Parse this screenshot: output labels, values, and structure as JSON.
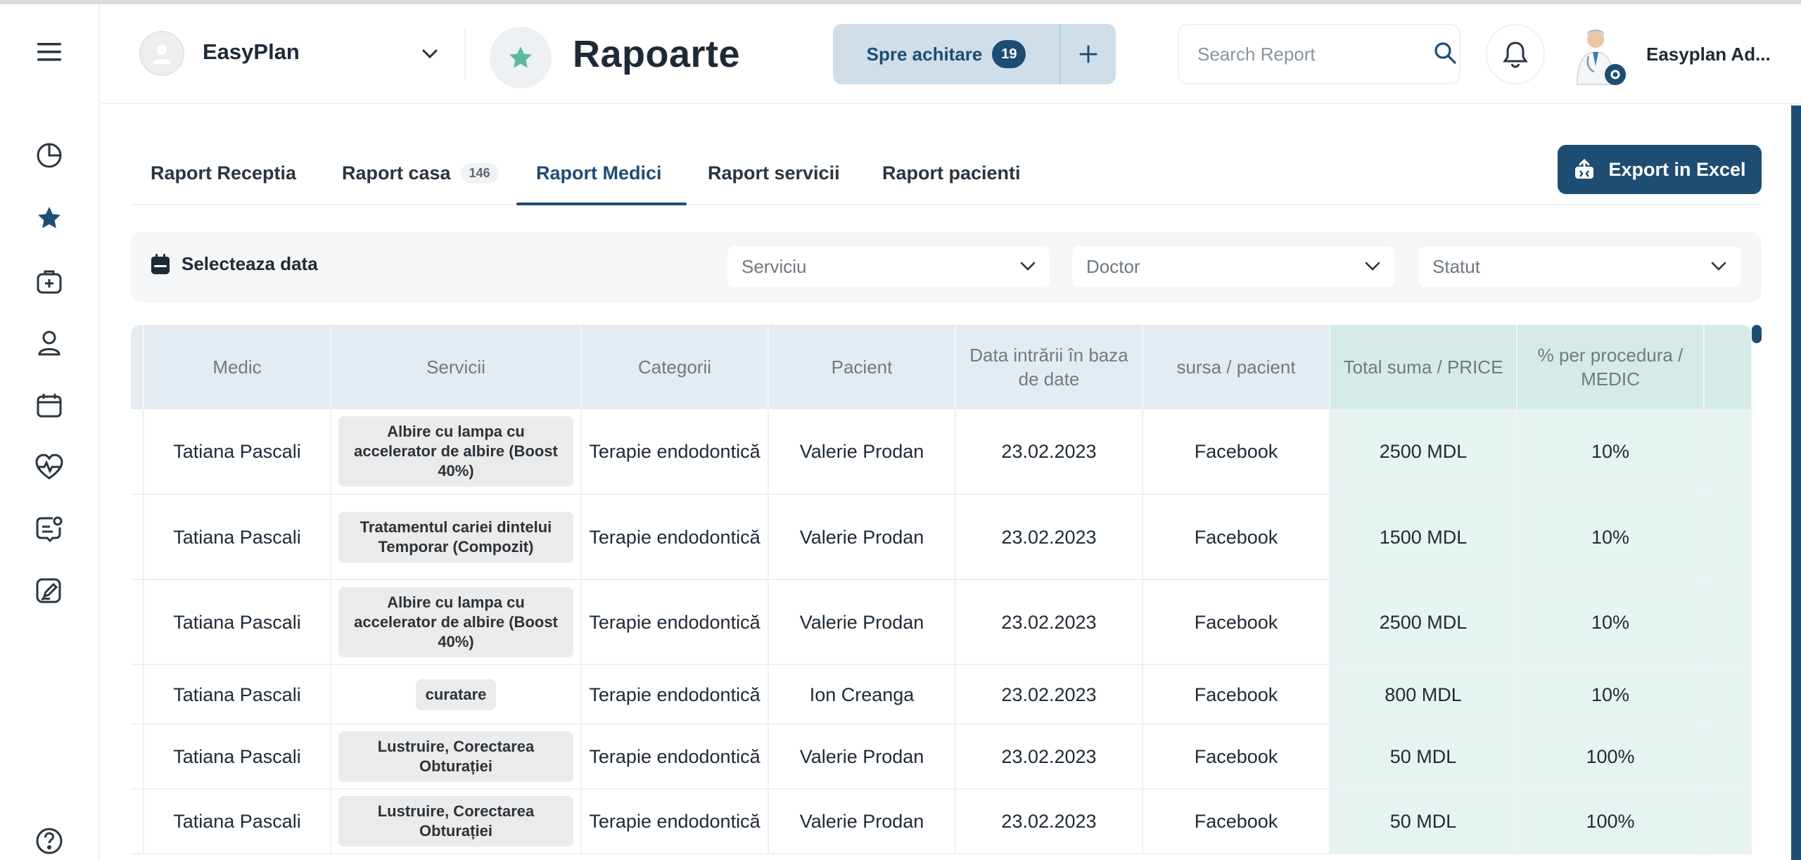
{
  "header": {
    "clinic_name": "EasyPlan",
    "page_title": "Rapoarte",
    "pay_label": "Spre achitare",
    "pay_count": "19",
    "search_placeholder": "Search Report",
    "user_name": "Easyplan Ad..."
  },
  "sidebar": {
    "icons": [
      "menu-icon",
      "pie-chart-icon",
      "star-icon",
      "medical-bag-icon",
      "user-icon",
      "calendar-icon",
      "heart-pulse-icon",
      "message-user-icon",
      "edit-document-icon",
      "help-icon"
    ]
  },
  "tabs": [
    {
      "label": "Raport Receptia",
      "badge": ""
    },
    {
      "label": "Raport casa",
      "badge": "146"
    },
    {
      "label": "Raport Medici",
      "badge": ""
    },
    {
      "label": "Raport servicii",
      "badge": ""
    },
    {
      "label": "Raport pacienti",
      "badge": ""
    }
  ],
  "active_tab": "Raport Medici",
  "export_label": "Export in Excel",
  "filters": {
    "date_label": "Selecteaza data",
    "service": "Serviciu",
    "doctor": "Doctor",
    "status": "Statut"
  },
  "table": {
    "columns": [
      "Medic",
      "Servicii",
      "Categorii",
      "Pacient",
      "Data intrării în baza de date",
      "sursa / pacient",
      "Total suma / PRICE",
      "% per procedura / MEDIC"
    ],
    "rows": [
      {
        "medic": "Tatiana Pascali",
        "service": "Albire cu lampa cu accelerator de albire (Boost 40%)",
        "category": "Terapie endodontică",
        "patient": "Valerie Prodan",
        "date": "23.02.2023",
        "source": "Facebook",
        "total": "2500 MDL",
        "percent": "10%"
      },
      {
        "medic": "Tatiana Pascali",
        "service": "Tratamentul cariei dintelui Temporar (Compozit)",
        "category": "Terapie endodontică",
        "patient": "Valerie Prodan",
        "date": "23.02.2023",
        "source": "Facebook",
        "total": "1500 MDL",
        "percent": "10%"
      },
      {
        "medic": "Tatiana Pascali",
        "service": "Albire cu lampa cu accelerator de albire (Boost 40%)",
        "category": "Terapie endodontică",
        "patient": "Valerie Prodan",
        "date": "23.02.2023",
        "source": "Facebook",
        "total": "2500 MDL",
        "percent": "10%"
      },
      {
        "medic": "Tatiana Pascali",
        "service": "curatare",
        "category": "Terapie endodontică",
        "patient": "Ion Creanga",
        "date": "23.02.2023",
        "source": "Facebook",
        "total": "800 MDL",
        "percent": "10%"
      },
      {
        "medic": "Tatiana Pascali",
        "service": "Lustruire, Corectarea Obturației",
        "category": "Terapie endodontică",
        "patient": "Valerie Prodan",
        "date": "23.02.2023",
        "source": "Facebook",
        "total": "50 MDL",
        "percent": "100%"
      },
      {
        "medic": "Tatiana Pascali",
        "service": "Lustruire, Corectarea Obturației",
        "category": "Terapie endodontică",
        "patient": "Valerie Prodan",
        "date": "23.02.2023",
        "source": "Facebook",
        "total": "50 MDL",
        "percent": "100%"
      }
    ]
  },
  "colors": {
    "accent": "#1e4d74",
    "star": "#5fb8a0",
    "teal_column": "#e6f3f1"
  }
}
